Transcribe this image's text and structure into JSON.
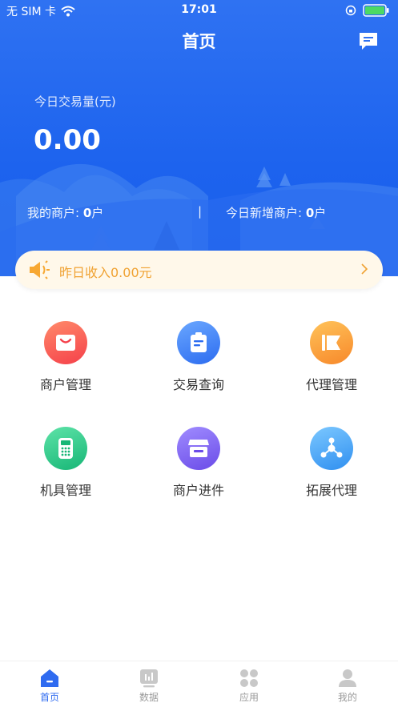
{
  "status_bar": {
    "carrier": "无 SIM 卡",
    "time": "17:01"
  },
  "header": {
    "title": "首页",
    "message_icon": "message-icon"
  },
  "summary": {
    "volume_label": "今日交易量(元)",
    "volume_value": "0.00",
    "my_merchants_label": "我的商户:",
    "my_merchants_value": "0",
    "my_merchants_unit": "户",
    "divider": "|",
    "new_merchants_label": "今日新增商户:",
    "new_merchants_value": "0",
    "new_merchants_unit": "户"
  },
  "notice": {
    "text": "昨日收入0.00元",
    "icon": "speaker-icon"
  },
  "menu": [
    {
      "label": "商户管理",
      "icon": "bag-icon",
      "color": "#f7524a"
    },
    {
      "label": "交易查询",
      "icon": "clipboard-icon",
      "color": "#3f7cf5"
    },
    {
      "label": "代理管理",
      "icon": "flag-icon",
      "color": "#f99a2c"
    },
    {
      "label": "机具管理",
      "icon": "pos-terminal-icon",
      "color": "#22c185"
    },
    {
      "label": "商户进件",
      "icon": "store-icon",
      "color": "#7b5ef0"
    },
    {
      "label": "拓展代理",
      "icon": "network-icon",
      "color": "#3aa2f5"
    }
  ],
  "tabs": [
    {
      "label": "首页",
      "icon": "home-icon",
      "active": true
    },
    {
      "label": "数据",
      "icon": "chart-icon",
      "active": false
    },
    {
      "label": "应用",
      "icon": "apps-icon",
      "active": false
    },
    {
      "label": "我的",
      "icon": "profile-icon",
      "active": false
    }
  ]
}
